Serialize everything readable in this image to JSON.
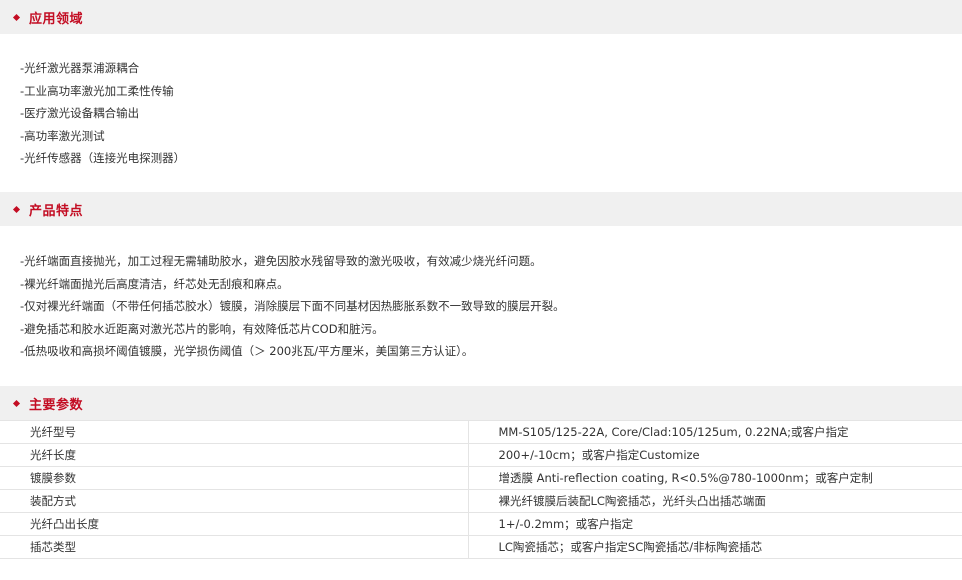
{
  "sections": {
    "application": {
      "title": "应用领域",
      "items": [
        "-光纤激光器泵浦源耦合",
        "-工业高功率激光加工柔性传输",
        "-医疗激光设备耦合输出",
        "-高功率激光测试",
        "-光纤传感器（连接光电探测器）"
      ]
    },
    "features": {
      "title": "产品特点",
      "items": [
        "-光纤端面直接抛光，加工过程无需辅助胶水，避免因胶水残留导致的激光吸收，有效减少烧光纤问题。",
        "-裸光纤端面抛光后高度清洁，纤芯处无刮痕和麻点。",
        "-仅对裸光纤端面（不带任何插芯胶水）镀膜，消除膜层下面不同基材因热膨胀系数不一致导致的膜层开裂。",
        "-避免插芯和胶水近距离对激光芯片的影响，有效降低芯片COD和脏污。",
        "-低热吸收和高损坏阈值镀膜，光学损伤阈值（＞ 200兆瓦/平方厘米，美国第三方认证）。"
      ]
    },
    "parameters": {
      "title": "主要参数",
      "rows": [
        {
          "key": "光纤型号",
          "value": "MM-S105/125-22A, Core/Clad:105/125um, 0.22NA;或客户指定"
        },
        {
          "key": "光纤长度",
          "value": "200+/-10cm；或客户指定Customize"
        },
        {
          "key": "镀膜参数",
          "value": "增透膜 Anti-reflection coating, R<0.5%@780-1000nm；或客户定制"
        },
        {
          "key": "装配方式",
          "value": "裸光纤镀膜后装配LC陶瓷插芯，光纤头凸出插芯端面"
        },
        {
          "key": "光纤凸出长度",
          "value": "1+/-0.2mm；或客户指定"
        },
        {
          "key": "插芯类型",
          "value": "LC陶瓷插芯；或客户指定SC陶瓷插芯/非标陶瓷插芯"
        }
      ]
    }
  },
  "colors": {
    "accent": "#c30d23",
    "header_bg": "#f0f0f0",
    "text": "#333333",
    "border": "#e4e4e4"
  },
  "icons": {
    "section_bullet": "diamond-icon"
  }
}
